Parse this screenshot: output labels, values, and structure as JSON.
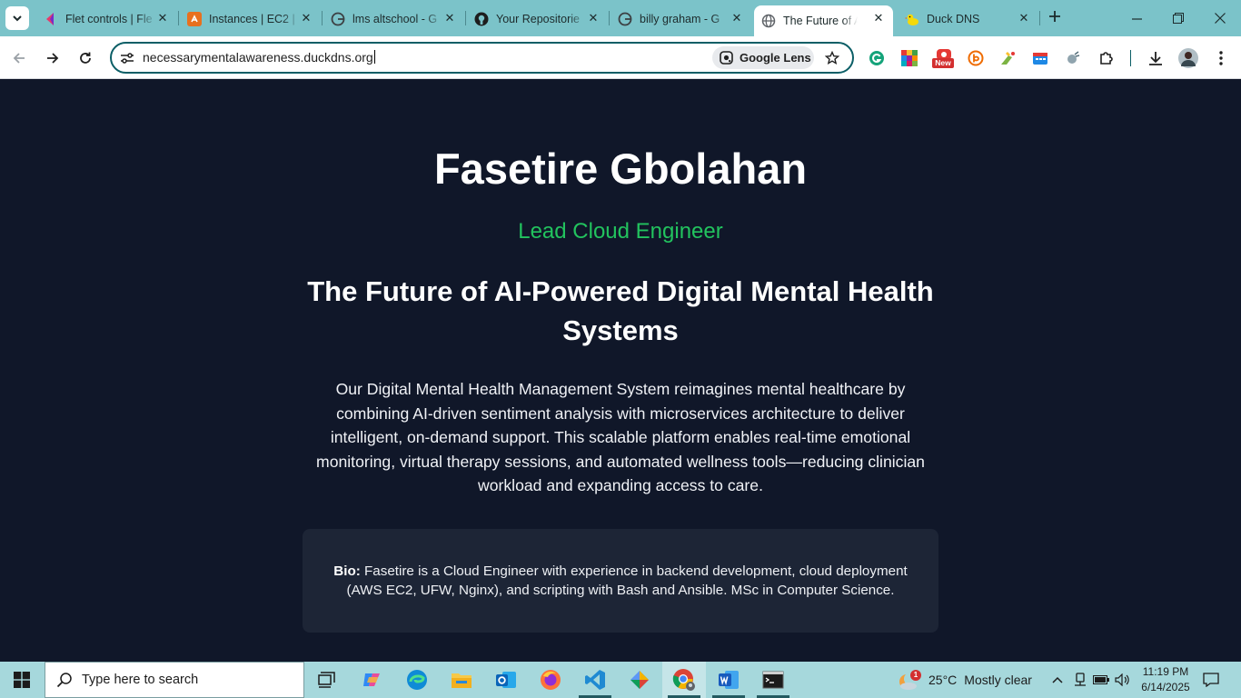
{
  "browser": {
    "tabs": [
      {
        "title": "Flet controls | Fle",
        "icon": "flet-icon",
        "active": false
      },
      {
        "title": "Instances | EC2 |",
        "icon": "aws-icon",
        "active": false
      },
      {
        "title": "lms altschool - G",
        "icon": "google-icon",
        "active": false
      },
      {
        "title": "Your Repositorie",
        "icon": "github-icon",
        "active": false
      },
      {
        "title": "billy graham - G",
        "icon": "google-icon",
        "active": false
      },
      {
        "title": "The Future of AI",
        "icon": "globe-icon",
        "active": true
      },
      {
        "title": "Duck DNS",
        "icon": "duck-icon",
        "active": false
      }
    ],
    "url": "necessarymentalawareness.duckdns.org",
    "lens_label": "Google Lens",
    "ext_badge": "New"
  },
  "page": {
    "name": "Fasetire Gbolahan",
    "role": "Lead Cloud Engineer",
    "headline": "The Future of AI-Powered Digital Mental Health Systems",
    "description": "Our Digital Mental Health Management System reimagines mental healthcare by combining AI-driven sentiment analysis with microservices architecture to deliver intelligent, on-demand support. This scalable platform enables real-time emotional monitoring, virtual therapy sessions, and automated wellness tools—reducing clinician workload and expanding access to care.",
    "bio_label": "Bio:",
    "bio_text": "Fasetire is a Cloud Engineer with experience in backend development, cloud deployment (AWS EC2, UFW, Nginx), and scripting with Bash and Ansible. MSc in Computer Science."
  },
  "taskbar": {
    "search_placeholder": "Type here to search",
    "weather_badge": "1",
    "temperature": "25°C",
    "weather_text": "Mostly clear",
    "time": "11:19 PM",
    "date": "6/14/2025"
  },
  "colors": {
    "page_bg": "#101729",
    "accent_green": "#22c35e",
    "bio_card_bg": "#1d2536",
    "tabstrip_bg": "#7bc3c9",
    "taskbar_bg": "#a6d8dc"
  }
}
